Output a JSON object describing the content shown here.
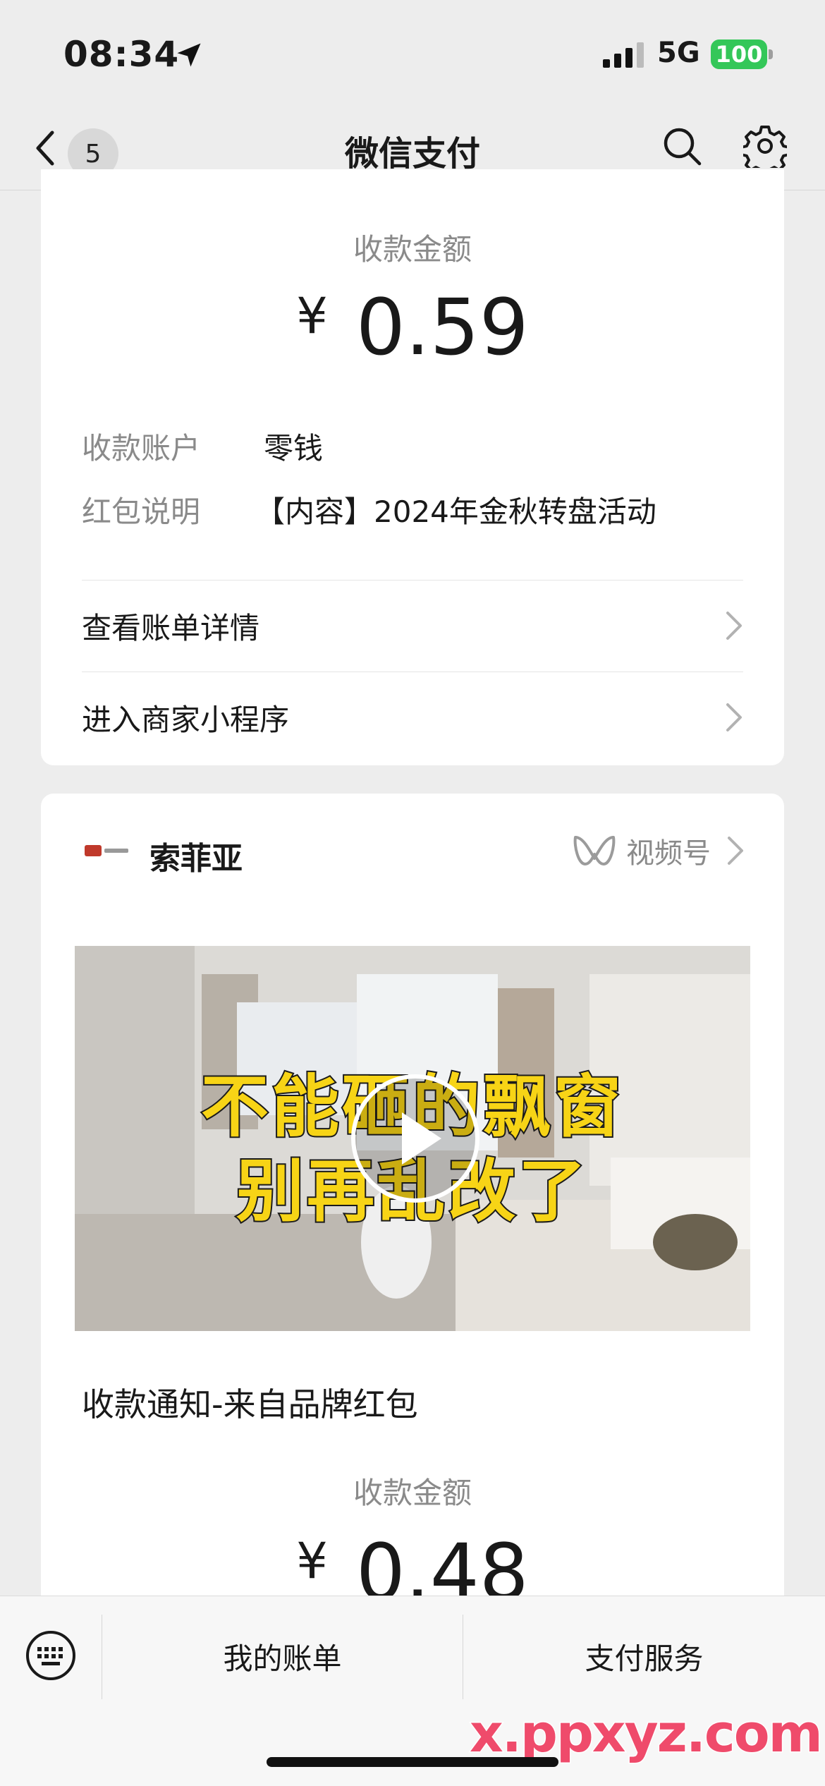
{
  "status": {
    "time": "08:34",
    "network": "5G",
    "battery": "100"
  },
  "nav": {
    "back_count": "5",
    "title": "微信支付"
  },
  "payment1": {
    "amount_label": "收款金额",
    "currency": "¥",
    "amount": "0.59",
    "rows": [
      {
        "key": "收款账户",
        "value": "零钱"
      },
      {
        "key": "红包说明",
        "value": "【内容】2024年金秋转盘活动"
      }
    ],
    "links": [
      "查看账单详情",
      "进入商家小程序"
    ]
  },
  "payment2": {
    "brand_name": "索菲亚",
    "channel_label": "视频号",
    "video_lines": [
      "不能砸的飘窗",
      "别再乱改了"
    ],
    "notice_title": "收款通知-来自品牌红包",
    "amount_label": "收款金额",
    "currency": "¥",
    "amount": "0.48"
  },
  "bottom": {
    "left": "我的账单",
    "right": "支付服务",
    "watermark": "x.ppxyz.com"
  },
  "colors": {
    "background": "#ededed",
    "battery": "#34c759",
    "video_text": "#f7d416",
    "watermark": "#ef4b6b"
  }
}
